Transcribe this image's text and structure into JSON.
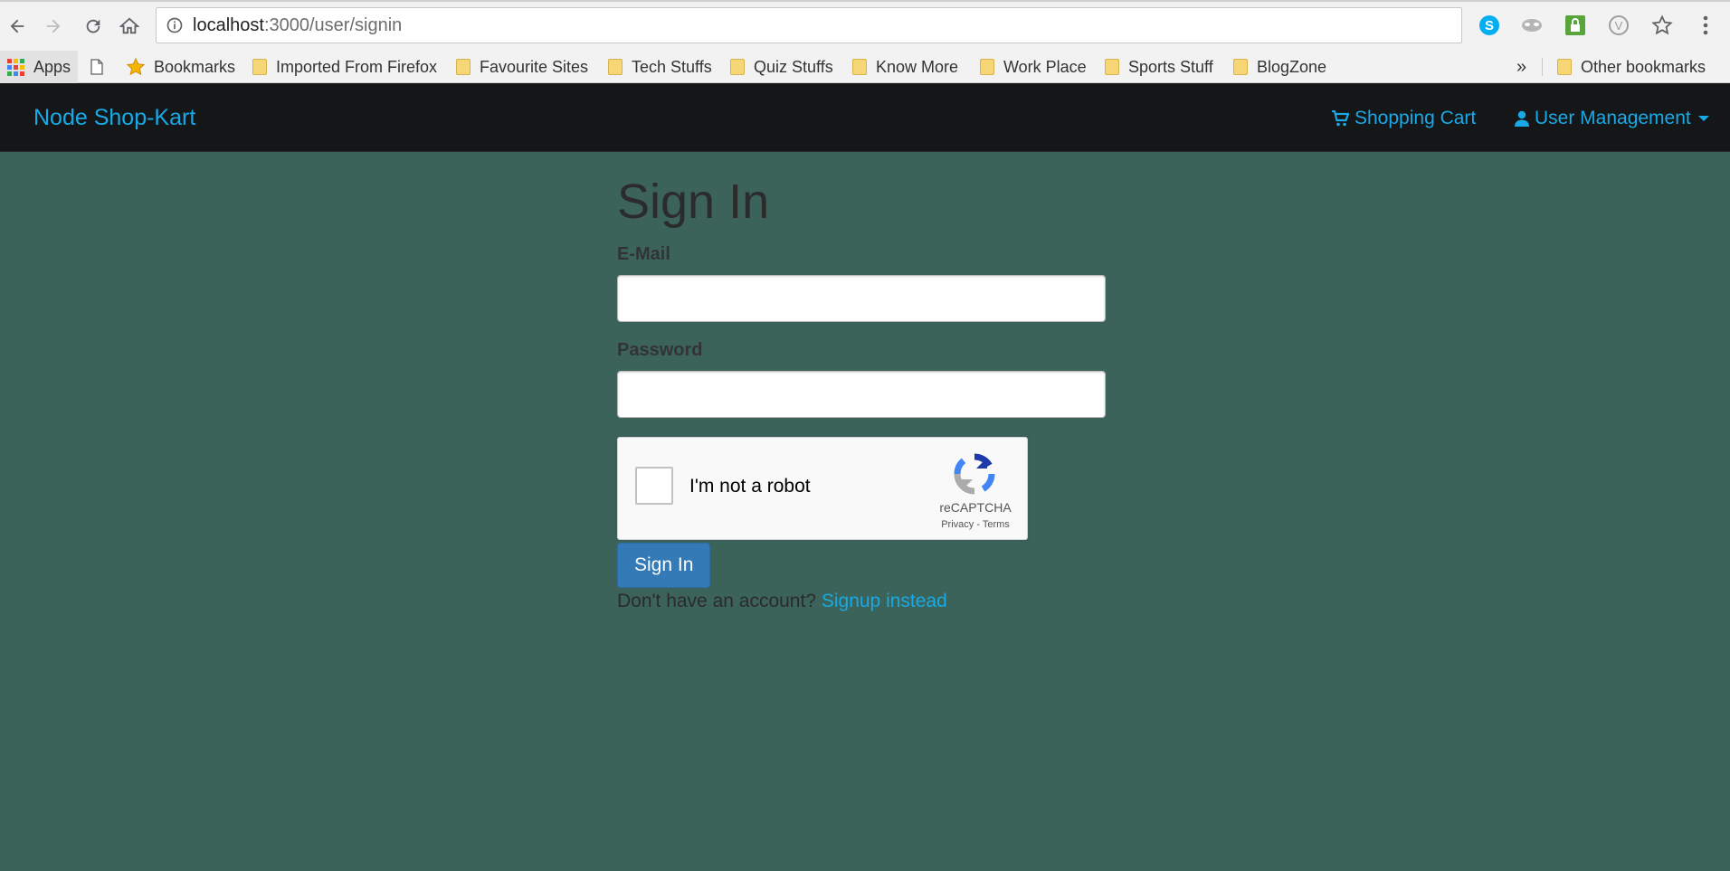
{
  "browser": {
    "url_host": "localhost",
    "url_path": ":3000/user/signin"
  },
  "bookmarks": {
    "apps": "Apps",
    "items": [
      "Bookmarks",
      "Imported From Firefox",
      "Favourite Sites",
      "Tech Stuffs",
      "Quiz Stuffs",
      "Know More",
      "Work Place",
      "Sports Stuff",
      "BlogZone"
    ],
    "overflow": "»",
    "other": "Other bookmarks"
  },
  "navbar": {
    "brand": "Node Shop-Kart",
    "cart": "Shopping Cart",
    "user_menu": "User Management"
  },
  "form": {
    "title": "Sign In",
    "email_label": "E-Mail",
    "email_value": "",
    "password_label": "Password",
    "password_value": "",
    "captcha_text": "I'm not a robot",
    "captcha_brand": "reCAPTCHA",
    "captcha_links": "Privacy - Terms",
    "submit": "Sign In",
    "signup_prompt": "Don't have an account?",
    "signup_link": "Signup instead"
  },
  "colors": {
    "page_bg": "#3b6359",
    "navbar_bg": "#141618",
    "link": "#19a9e6",
    "button": "#337ab7"
  }
}
